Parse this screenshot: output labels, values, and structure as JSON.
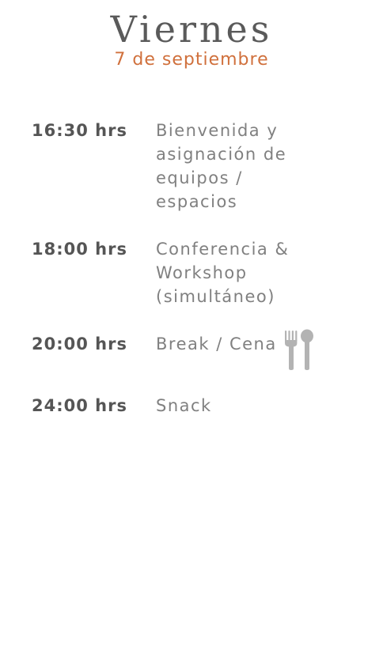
{
  "header": {
    "day": "Viernes",
    "date": "7 de septiembre"
  },
  "schedule": [
    {
      "time": "16:30 hrs",
      "activity": "Bienvenida y asignación de equipos / espacios"
    },
    {
      "time": "18:00 hrs",
      "activity": "Conferencia & Workshop (simultáneo)"
    },
    {
      "time": "20:00 hrs",
      "activity": "Break / Cena",
      "icon": "utensils-icon"
    },
    {
      "time": "24:00 hrs",
      "activity": "Snack"
    }
  ],
  "colors": {
    "accent": "#d0703c",
    "time_text": "#555555",
    "activity_text": "#808080",
    "icon": "#b3b3b3"
  }
}
